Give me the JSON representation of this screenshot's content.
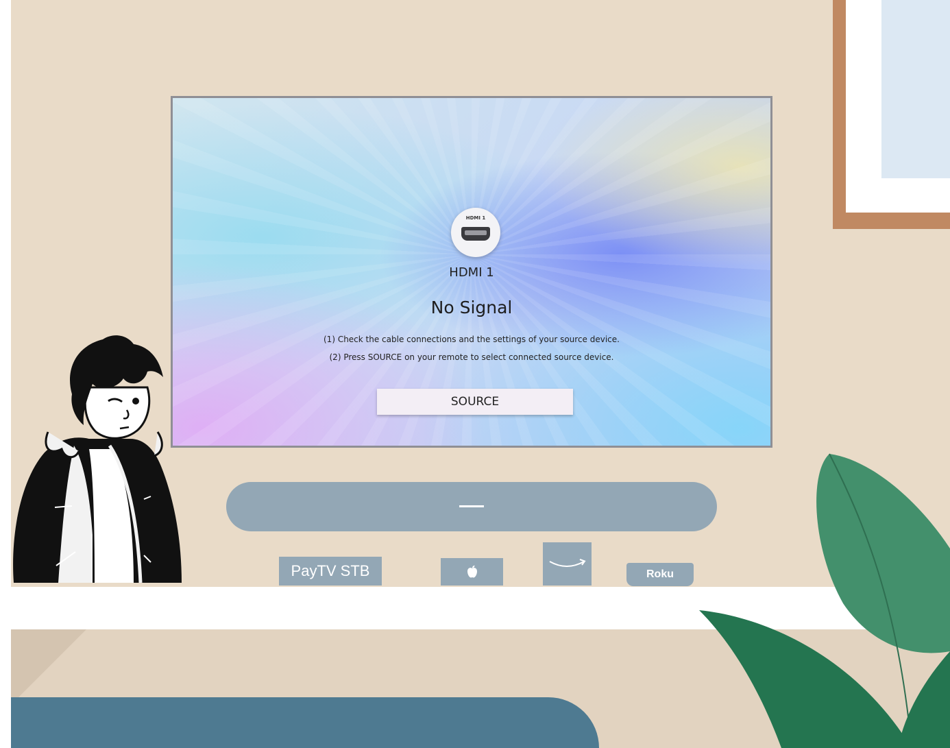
{
  "tv_screen": {
    "port_badge": "HDMI 1",
    "input_name": "HDMI 1",
    "title": "No Signal",
    "instructions": [
      "(1) Check the cable connections and the settings of your source device.",
      "(2) Press SOURCE on your remote to select connected source device."
    ],
    "source_button": "SOURCE"
  },
  "devices": {
    "stb_label": "PayTV STB",
    "appletv_logo": "",
    "roku_label": "Roku"
  },
  "icons": {
    "port": "hdmi-port-icon",
    "apple": "apple-logo-icon",
    "amazon": "amazon-smile-icon"
  },
  "colors": {
    "wall": "#e9dbc8",
    "device_gray": "#93a7b5",
    "floor": "#4e7a91",
    "frame": "#c08962",
    "leaf_light": "#43906c",
    "leaf_dark": "#247550"
  }
}
